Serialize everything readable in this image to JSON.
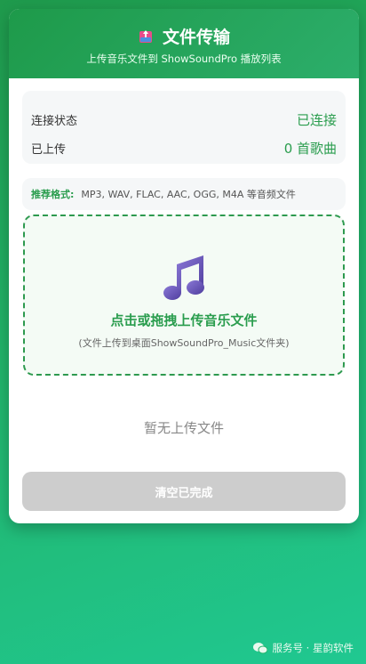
{
  "header": {
    "icon": "book-upload-icon",
    "title": "文件传输",
    "subtitle": "上传音乐文件到 ShowSoundPro 播放列表"
  },
  "status": {
    "connection_label": "连接状态",
    "connection_value": "已连接",
    "uploaded_label": "已上传",
    "uploaded_value": "0 首歌曲"
  },
  "formats": {
    "label": "推荐格式:",
    "text": "MP3, WAV, FLAC, AAC, OGG, M4A 等音频文件"
  },
  "dropzone": {
    "icon": "music-note-icon",
    "title": "点击或拖拽上传音乐文件",
    "hint": "(文件上传到桌面ShowSoundPro_Music文件夹)"
  },
  "empty_text": "暂无上传文件",
  "clear_button": "清空已完成",
  "footer": {
    "icon": "wechat-icon",
    "text": "服务号 · 星韵软件"
  },
  "colors": {
    "accent": "#2a9d4e",
    "header_bg": "#1e9a4a",
    "disabled_button": "#cdcdcd"
  }
}
